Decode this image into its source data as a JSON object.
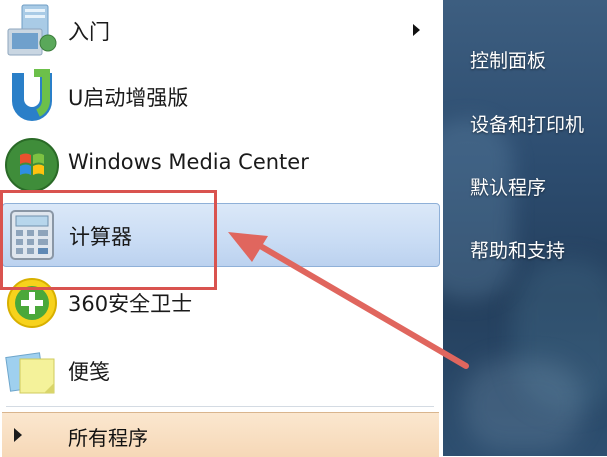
{
  "start_menu": {
    "programs": [
      {
        "label": "入门",
        "icon": "getting-started-icon",
        "has_submenu": true
      },
      {
        "label": "U启动增强版",
        "icon": "u-startup-icon",
        "has_submenu": false
      },
      {
        "label": "Windows Media Center",
        "icon": "media-center-icon",
        "has_submenu": false
      },
      {
        "label": "计算器",
        "icon": "calculator-icon",
        "has_submenu": false,
        "selected": true
      },
      {
        "label": "360安全卫士",
        "icon": "360-safe-icon",
        "has_submenu": false
      },
      {
        "label": "便笺",
        "icon": "sticky-notes-icon",
        "has_submenu": false
      }
    ],
    "all_programs_label": "所有程序",
    "right_items": [
      {
        "label": "控制面板"
      },
      {
        "label": "设备和打印机"
      },
      {
        "label": "默认程序"
      },
      {
        "label": "帮助和支持"
      }
    ]
  },
  "annotation": {
    "highlight_color": "#d9534f",
    "arrow_color": "#e0665e"
  }
}
